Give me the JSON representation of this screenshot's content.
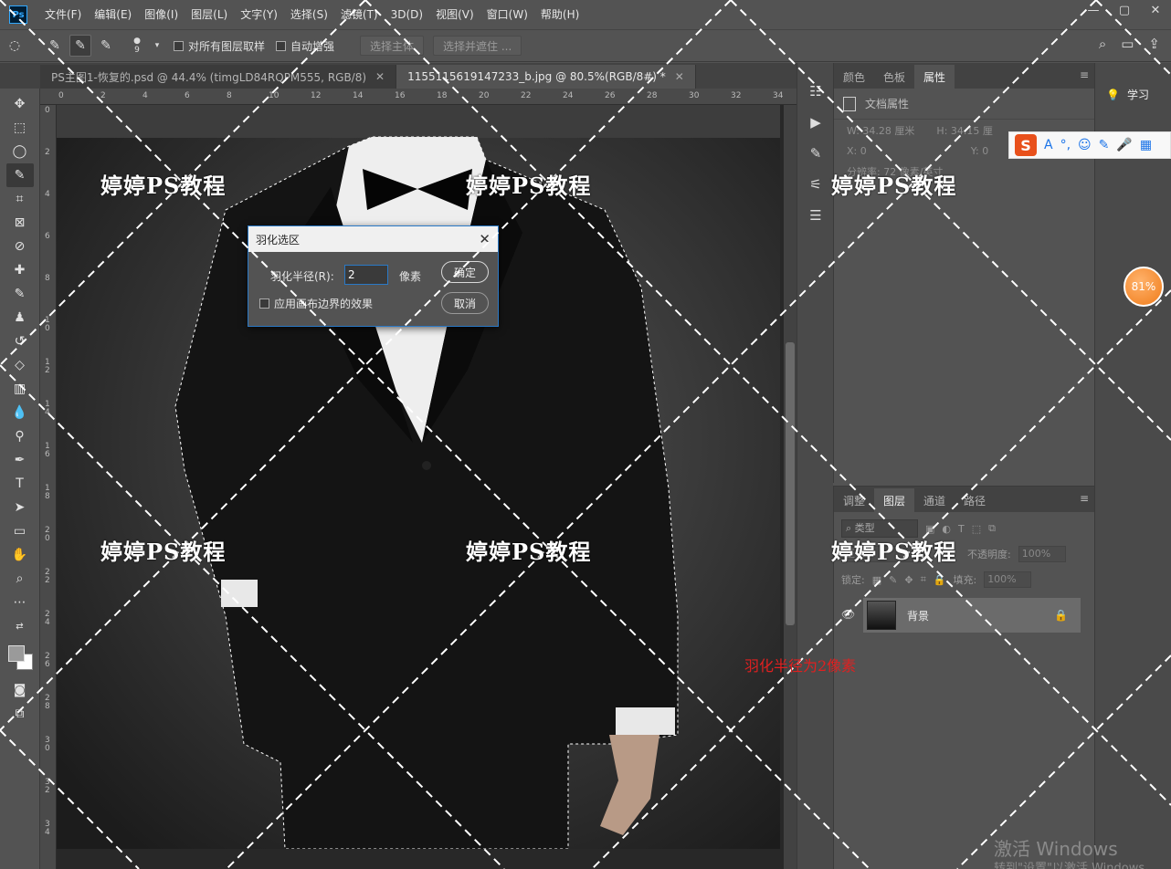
{
  "app": {
    "logo": "Ps",
    "menu": [
      "文件(F)",
      "编辑(E)",
      "图像(I)",
      "图层(L)",
      "文字(Y)",
      "选择(S)",
      "滤镜(T)",
      "3D(D)",
      "视图(V)",
      "窗口(W)",
      "帮助(H)"
    ],
    "window_controls": [
      "—",
      "▢",
      "✕"
    ]
  },
  "options": {
    "brush_size": "9",
    "sample_all_layers": "对所有图层取样",
    "auto_enhance": "自动增强",
    "select_subject": "选择主体",
    "select_and_mask": "选择并遮住 ..."
  },
  "tabs": [
    {
      "label": "PS主图1-恢复的.psd @ 44.4% (timgLD84RQPM555, RGB/8)",
      "close": "✕"
    },
    {
      "label": "1155115619147233_b.jpg @ 80.5%(RGB/8#) *",
      "close": "✕"
    }
  ],
  "rulers": {
    "top": [
      "0",
      "2",
      "4",
      "6",
      "8",
      "10",
      "12",
      "14",
      "16",
      "18",
      "20",
      "22",
      "24",
      "26",
      "28",
      "30",
      "32",
      "34"
    ],
    "left": [
      "0",
      "2",
      "4",
      "6",
      "8",
      "1\n0",
      "1\n2",
      "1\n4",
      "1\n6",
      "1\n8",
      "2\n0",
      "2\n2",
      "2\n4",
      "2\n6",
      "2\n8",
      "3\n0",
      "3\n2",
      "3\n4"
    ]
  },
  "dialog": {
    "title": "羽化选区",
    "radius_label": "羽化半径(R):",
    "radius_value": "2",
    "radius_unit": "像素",
    "ok": "确定",
    "cancel": "取消",
    "canvas_bounds": "应用画布边界的效果"
  },
  "properties_panel": {
    "tabs": [
      "颜色",
      "色板",
      "属性"
    ],
    "doc_props": "文档属性",
    "w": "W:  34.28  厘米",
    "h": "H:  34.15  厘",
    "x": "X:  0",
    "y": "Y:  0",
    "resolution": "分辨率: 72 像素/英寸"
  },
  "layers_panel": {
    "tabs": [
      "调整",
      "图层",
      "通道",
      "路径"
    ],
    "search": "类型",
    "blend_mode": "正常",
    "opacity_label": "不透明度:",
    "opacity_value": "100%",
    "lock_label": "锁定:",
    "fill_label": "填充:",
    "fill_value": "100%",
    "layer_name": "背景"
  },
  "learn": {
    "label": "学习"
  },
  "ime": {
    "logo": "S"
  },
  "zoom_badge": "81%",
  "watermarks": [
    "婷婷PS教程",
    "婷婷PS教程",
    "婷婷PS教程",
    "婷婷PS教程",
    "婷婷PS教程",
    "婷婷PS教程"
  ],
  "annotation": "羽化半径为2像素",
  "windows_activation": {
    "title": "激活 Windows",
    "sub": "转到\"设置\"以激活 Windows。"
  },
  "colors": {
    "accent": "#2a79c6",
    "annotation": "#e02020",
    "badge": "#f07c1a"
  }
}
